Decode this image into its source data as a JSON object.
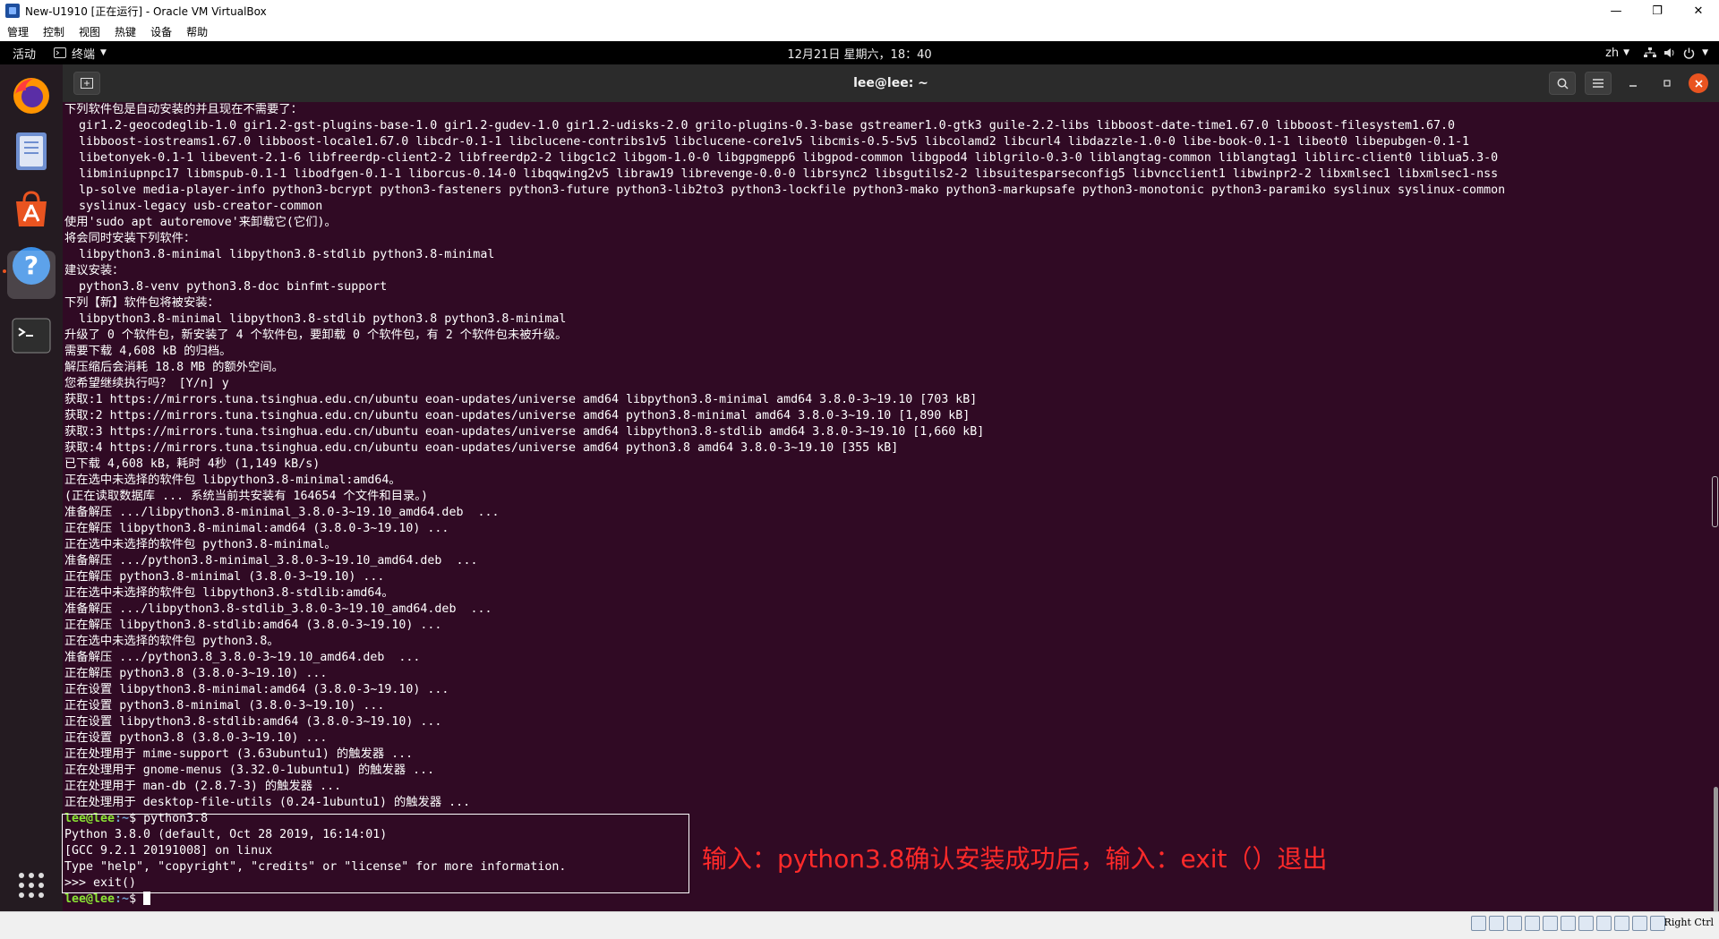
{
  "vbox": {
    "title": "New-U1910 [正在运行] - Oracle VM VirtualBox",
    "menu": [
      "管理",
      "控制",
      "视图",
      "热键",
      "设备",
      "帮助"
    ],
    "host_key": "Right Ctrl"
  },
  "gnome": {
    "activities": "活动",
    "app_menu": "终端",
    "clock": "12月21日 星期六，18：40",
    "lang": "zh"
  },
  "dock": {
    "items": [
      "Firefox",
      "Files",
      "Ubuntu Software",
      "Help",
      "Terminal"
    ]
  },
  "terminal": {
    "title": "lee@lee: ~",
    "lines": [
      "下列软件包是自动安装的并且现在不需要了：",
      "  gir1.2-geocodeglib-1.0 gir1.2-gst-plugins-base-1.0 gir1.2-gudev-1.0 gir1.2-udisks-2.0 grilo-plugins-0.3-base gstreamer1.0-gtk3 guile-2.2-libs libboost-date-time1.67.0 libboost-filesystem1.67.0",
      "  libboost-iostreams1.67.0 libboost-locale1.67.0 libcdr-0.1-1 libclucene-contribs1v5 libclucene-core1v5 libcmis-0.5-5v5 libcolamd2 libcurl4 libdazzle-1.0-0 libe-book-0.1-1 libeot0 libepubgen-0.1-1",
      "  libetonyek-0.1-1 libevent-2.1-6 libfreerdp-client2-2 libfreerdp2-2 libgc1c2 libgom-1.0-0 libgpgmepp6 libgpod-common libgpod4 liblgrilo-0.3-0 liblangtag-common liblangtag1 liblirc-client0 liblua5.3-0",
      "  libminiupnpc17 libmspub-0.1-1 libodfgen-0.1-1 liborcus-0.14-0 libqqwing2v5 libraw19 librevenge-0.0-0 librsync2 libsgutils2-2 libsuitesparseconfig5 libvncclient1 libwinpr2-2 libxmlsec1 libxmlsec1-nss",
      "  lp-solve media-player-info python3-bcrypt python3-fasteners python3-future python3-lib2to3 python3-lockfile python3-mako python3-markupsafe python3-monotonic python3-paramiko syslinux syslinux-common",
      "  syslinux-legacy usb-creator-common",
      "使用'sudo apt autoremove'来卸载它(它们)。",
      "将会同时安装下列软件：",
      "  libpython3.8-minimal libpython3.8-stdlib python3.8-minimal",
      "建议安装：",
      "  python3.8-venv python3.8-doc binfmt-support",
      "下列【新】软件包将被安装：",
      "  libpython3.8-minimal libpython3.8-stdlib python3.8 python3.8-minimal",
      "升级了 0 个软件包，新安装了 4 个软件包，要卸载 0 个软件包，有 2 个软件包未被升级。",
      "需要下载 4,608 kB 的归档。",
      "解压缩后会消耗 18.8 MB 的额外空间。",
      "您希望继续执行吗？ [Y/n] y",
      "获取:1 https://mirrors.tuna.tsinghua.edu.cn/ubuntu eoan-updates/universe amd64 libpython3.8-minimal amd64 3.8.0-3~19.10 [703 kB]",
      "获取:2 https://mirrors.tuna.tsinghua.edu.cn/ubuntu eoan-updates/universe amd64 python3.8-minimal amd64 3.8.0-3~19.10 [1,890 kB]",
      "获取:3 https://mirrors.tuna.tsinghua.edu.cn/ubuntu eoan-updates/universe amd64 libpython3.8-stdlib amd64 3.8.0-3~19.10 [1,660 kB]",
      "获取:4 https://mirrors.tuna.tsinghua.edu.cn/ubuntu eoan-updates/universe amd64 python3.8 amd64 3.8.0-3~19.10 [355 kB]",
      "已下载 4,608 kB，耗时 4秒 (1,149 kB/s)",
      "正在选中未选择的软件包 libpython3.8-minimal:amd64。",
      "(正在读取数据库 ... 系统当前共安装有 164654 个文件和目录。)",
      "准备解压 .../libpython3.8-minimal_3.8.0-3~19.10_amd64.deb  ...",
      "正在解压 libpython3.8-minimal:amd64 (3.8.0-3~19.10) ...",
      "正在选中未选择的软件包 python3.8-minimal。",
      "准备解压 .../python3.8-minimal_3.8.0-3~19.10_amd64.deb  ...",
      "正在解压 python3.8-minimal (3.8.0-3~19.10) ...",
      "正在选中未选择的软件包 libpython3.8-stdlib:amd64。",
      "准备解压 .../libpython3.8-stdlib_3.8.0-3~19.10_amd64.deb  ...",
      "正在解压 libpython3.8-stdlib:amd64 (3.8.0-3~19.10) ...",
      "正在选中未选择的软件包 python3.8。",
      "准备解压 .../python3.8_3.8.0-3~19.10_amd64.deb  ...",
      "正在解压 python3.8 (3.8.0-3~19.10) ...",
      "正在设置 libpython3.8-minimal:amd64 (3.8.0-3~19.10) ...",
      "正在设置 python3.8-minimal (3.8.0-3~19.10) ...",
      "正在设置 libpython3.8-stdlib:amd64 (3.8.0-3~19.10) ...",
      "正在设置 python3.8 (3.8.0-3~19.10) ...",
      "正在处理用于 mime-support (3.63ubuntu1) 的触发器 ...",
      "正在处理用于 gnome-menus (3.32.0-1ubuntu1) 的触发器 ...",
      "正在处理用于 man-db (2.8.7-3) 的触发器 ...",
      "正在处理用于 desktop-file-utils (0.24-1ubuntu1) 的触发器 ..."
    ],
    "prompt_user": "lee@lee",
    "prompt_path": ":~",
    "prompt_symbol": "$ ",
    "command": "python3.8",
    "python_lines": [
      "Python 3.8.0 (default, Oct 28 2019, 16:14:01)",
      "[GCC 9.2.1 20191008] on linux",
      "Type \"help\", \"copyright\", \"credits\" or \"license\" for more information.",
      ">>> exit()"
    ]
  },
  "annotation": {
    "text": "输入：python3.8确认安装成功后，输入：exit（）退出",
    "color": "#ff2a2a"
  },
  "colors": {
    "terminal_bg": "#300a24",
    "prompt_user": "#8ae234",
    "prompt_path": "#729fcf"
  }
}
